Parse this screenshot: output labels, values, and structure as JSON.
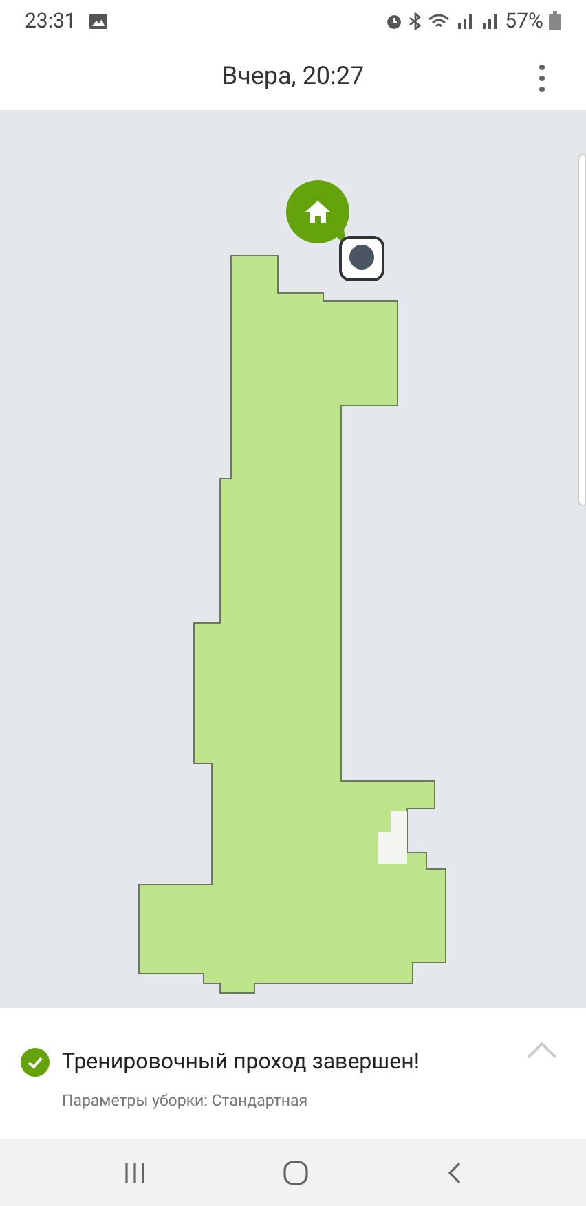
{
  "status_bar": {
    "time": "23:31",
    "battery": "57%"
  },
  "header": {
    "title": "Вчера, 20:27"
  },
  "notice": {
    "title": "Тренировочный проход завершен!",
    "subtitle": "Параметры уборки: Стандартная"
  }
}
